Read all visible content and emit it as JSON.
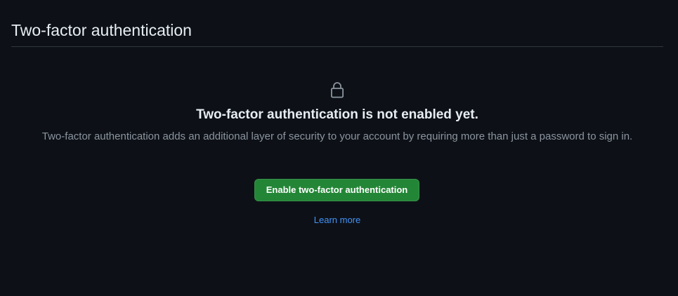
{
  "header": {
    "title": "Two-factor authentication"
  },
  "blankslate": {
    "icon": "lock-icon",
    "heading": "Two-factor authentication is not enabled yet.",
    "description": "Two-factor authentication adds an additional layer of security to your account by requiring more than just a password to sign in.",
    "enable_button_label": "Enable two-factor authentication",
    "learn_more_label": "Learn more"
  },
  "colors": {
    "background": "#0d1117",
    "primary_button": "#238636",
    "link": "#4493f8",
    "muted_text": "#8b949e"
  }
}
